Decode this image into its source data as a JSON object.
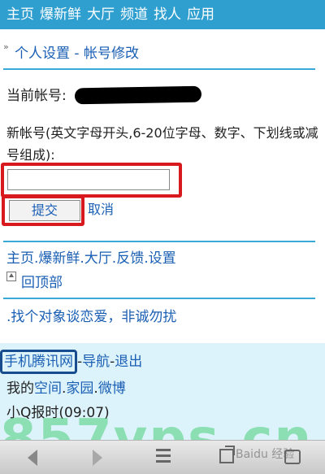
{
  "topnav": {
    "items": [
      "主页",
      "爆新鲜",
      "大厅",
      "频道",
      "找人",
      "应用"
    ]
  },
  "breadcrumb": {
    "text": "个人设置 - 帐号修改"
  },
  "account": {
    "current_label": "当前帐号:",
    "new_label": "新帐号(英文字母开头,6-20位字母、数字、下划线或减号组成):",
    "input_value": "",
    "submit_label": "提交",
    "cancel_label": "取消"
  },
  "section_links": {
    "text": "主页.爆新鲜.大厅.反馈.设置",
    "back_top": "回顶部"
  },
  "ad": {
    "text": ".找个对象谈恋爱，非诚勿扰"
  },
  "footer": {
    "brand": "手机腾讯网",
    "sep": "-",
    "nav": "导航",
    "exit": "退出",
    "my_prefix": "我的",
    "space": "空间",
    "home": "家园",
    "weibo": "微博",
    "report": "小Q报时(09:07)"
  },
  "watermark": {
    "text": "857vps.cn",
    "logo": "Baidu 经验"
  },
  "colors": {
    "topbar": "#2f9fd0",
    "link": "#1a5fb4",
    "highlight": "#d8191d",
    "footer_bg": "#ddf3fb"
  }
}
